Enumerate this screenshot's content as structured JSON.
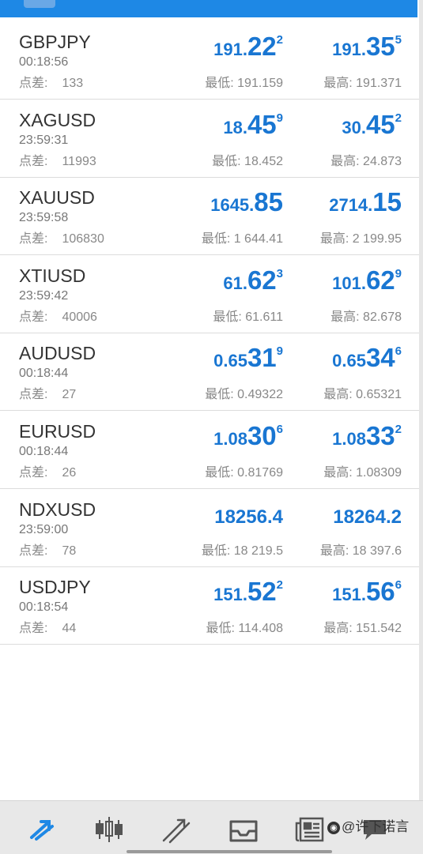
{
  "quotes": [
    {
      "symbol": "GBPJPY",
      "time": "00:18:56",
      "spread_label": "点差:",
      "spread": "133",
      "bid": {
        "small": "191.",
        "big": "22",
        "sup": "2"
      },
      "ask": {
        "small": "191.",
        "big": "35",
        "sup": "5"
      },
      "low": "最低: 191.159",
      "high": "最高: 191.371"
    },
    {
      "symbol": "XAGUSD",
      "time": "23:59:31",
      "spread_label": "点差:",
      "spread": "11993",
      "bid": {
        "small": "18.",
        "big": "45",
        "sup": "9"
      },
      "ask": {
        "small": "30.",
        "big": "45",
        "sup": "2"
      },
      "low": "最低: 18.452",
      "high": "最高: 24.873"
    },
    {
      "symbol": "XAUUSD",
      "time": "23:59:58",
      "spread_label": "点差:",
      "spread": "106830",
      "bid": {
        "small": "1645.",
        "big": "85",
        "sup": ""
      },
      "ask": {
        "small": "2714.",
        "big": "15",
        "sup": ""
      },
      "low": "最低: 1 644.41",
      "high": "最高: 2 199.95"
    },
    {
      "symbol": "XTIUSD",
      "time": "23:59:42",
      "spread_label": "点差:",
      "spread": "40006",
      "bid": {
        "small": "61.",
        "big": "62",
        "sup": "3"
      },
      "ask": {
        "small": "101.",
        "big": "62",
        "sup": "9"
      },
      "low": "最低: 61.611",
      "high": "最高: 82.678"
    },
    {
      "symbol": "AUDUSD",
      "time": "00:18:44",
      "spread_label": "点差:",
      "spread": "27",
      "bid": {
        "small": "0.65",
        "big": "31",
        "sup": "9"
      },
      "ask": {
        "small": "0.65",
        "big": "34",
        "sup": "6"
      },
      "low": "最低: 0.49322",
      "high": "最高: 0.65321"
    },
    {
      "symbol": "EURUSD",
      "time": "00:18:44",
      "spread_label": "点差:",
      "spread": "26",
      "bid": {
        "small": "1.08",
        "big": "30",
        "sup": "6"
      },
      "ask": {
        "small": "1.08",
        "big": "33",
        "sup": "2"
      },
      "low": "最低: 0.81769",
      "high": "最高: 1.08309"
    },
    {
      "symbol": "NDXUSD",
      "time": "23:59:00",
      "spread_label": "点差:",
      "spread": "78",
      "bid": {
        "small": "18256.4",
        "big": "",
        "sup": ""
      },
      "ask": {
        "small": "18264.2",
        "big": "",
        "sup": ""
      },
      "low": "最低: 18 219.5",
      "high": "最高: 18 397.6"
    },
    {
      "symbol": "USDJPY",
      "time": "00:18:54",
      "spread_label": "点差:",
      "spread": "44",
      "bid": {
        "small": "151.",
        "big": "52",
        "sup": "2"
      },
      "ask": {
        "small": "151.",
        "big": "56",
        "sup": "6"
      },
      "low": "最低: 114.408",
      "high": "最高: 151.542"
    }
  ],
  "bottom_nav": [
    {
      "icon": "quotes-icon",
      "active": true
    },
    {
      "icon": "chart-candles-icon",
      "active": false
    },
    {
      "icon": "trade-icon",
      "active": false
    },
    {
      "icon": "history-inbox-icon",
      "active": false
    },
    {
      "icon": "news-icon",
      "active": false
    },
    {
      "icon": "chat-icon",
      "active": false
    }
  ],
  "watermark": "@许下诺言",
  "colors": {
    "price": "#1976d2",
    "accent": "#1e88e5",
    "active_nav": "#1e88e5",
    "inactive_nav": "#555555"
  }
}
